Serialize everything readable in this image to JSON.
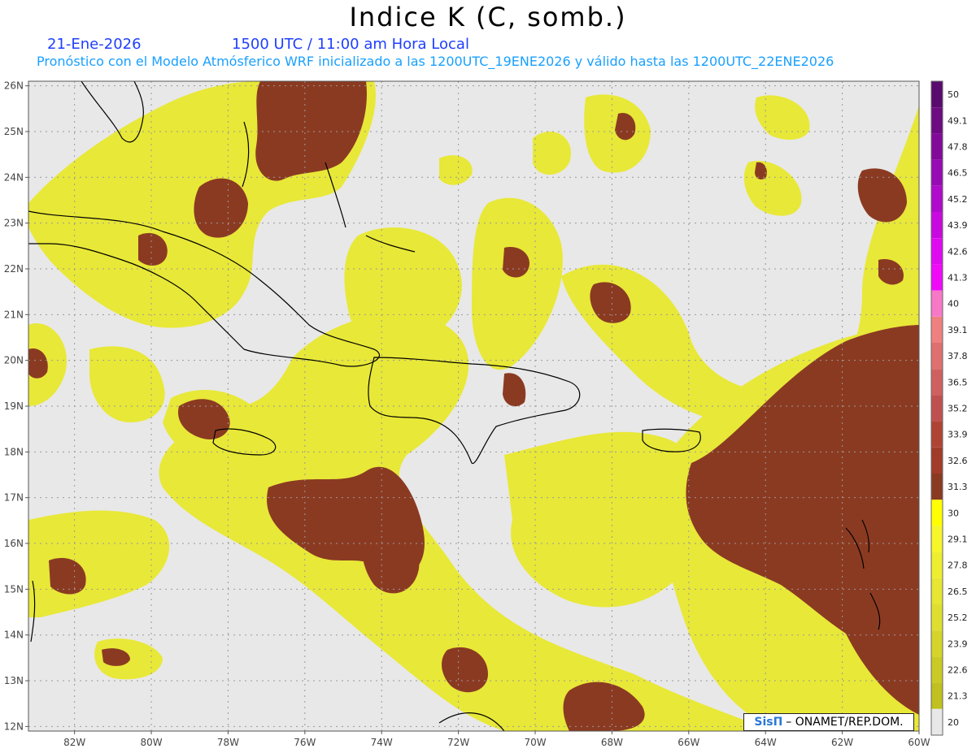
{
  "header": {
    "title": "Indice K (C, somb.)",
    "date": "21-Ene-2026",
    "time": "1500 UTC / 11:00 am Hora Local",
    "subtitle": "Pronóstico con el Modelo Atmósferico WRF inicializado a las 1200UTC_19ENE2026 y válido hasta las  1200UTC_22ENE2026"
  },
  "map": {
    "lon_range": [
      -83.2,
      -60
    ],
    "lat_range": [
      11.9,
      26.1
    ],
    "lon_ticks": [
      "82W",
      "80W",
      "78W",
      "76W",
      "74W",
      "72W",
      "70W",
      "68W",
      "66W",
      "64W",
      "62W",
      "60W"
    ],
    "lat_ticks": [
      "26N",
      "25N",
      "24N",
      "23N",
      "22N",
      "21N",
      "20N",
      "19N",
      "18N",
      "17N",
      "16N",
      "15N",
      "14N",
      "13N",
      "12N"
    ],
    "colors": {
      "background": "#e8e8e8",
      "yellow": "#e8e838",
      "bright_yellow": "#f4f42a",
      "brown": "#8b3a22",
      "coast": "#000000"
    }
  },
  "legend": {
    "levels": [
      "50",
      "49.1",
      "47.8",
      "46.5",
      "45.2",
      "43.9",
      "42.6",
      "41.3",
      "40",
      "39.1",
      "37.8",
      "36.5",
      "35.2",
      "33.9",
      "32.6",
      "31.3",
      "30",
      "29.1",
      "27.8",
      "26.5",
      "25.2",
      "23.9",
      "22.6",
      "21.3",
      "20"
    ],
    "colors": [
      "#5a0a6e",
      "#6e0a82",
      "#820a9a",
      "#980ab4",
      "#b00acc",
      "#c80ae0",
      "#e00af0",
      "#f00af8",
      "#f878c8",
      "#f08080",
      "#e07070",
      "#d06060",
      "#c05050",
      "#b04434",
      "#a03c28",
      "#8b3a22",
      "#ffff00",
      "#f6f62a",
      "#eeee30",
      "#e6e633",
      "#dede30",
      "#d4d42a",
      "#caca26",
      "#c0c020",
      "#e8e8e8"
    ]
  },
  "credit": {
    "logo": "SisΠ",
    "text": "– ONAMET/REP.DOM."
  }
}
